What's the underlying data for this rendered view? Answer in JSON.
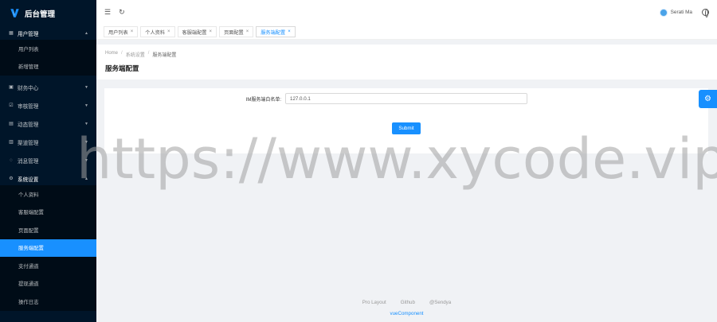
{
  "app": {
    "title": "后台管理"
  },
  "sidebar": {
    "groups": [
      {
        "label": "用户管理",
        "icon": "table-icon",
        "open": true,
        "items": [
          "用户列表",
          "新增管理"
        ]
      },
      {
        "label": "财务中心",
        "icon": "finance-icon"
      },
      {
        "label": "审核管理",
        "icon": "audit-icon"
      },
      {
        "label": "动态管理",
        "icon": "activity-icon"
      },
      {
        "label": "渠道管理",
        "icon": "channel-icon"
      },
      {
        "label": "消息管理",
        "icon": "message-icon"
      },
      {
        "label": "系统设置",
        "icon": "gear-icon",
        "open": true,
        "items": [
          "个人资料",
          "客服端配置",
          "页面配置",
          "服务端配置",
          "支付通道",
          "提现通道",
          "操作日志"
        ]
      }
    ]
  },
  "header": {
    "user_name": "Serati Ma"
  },
  "tabs": [
    {
      "label": "用户列表"
    },
    {
      "label": "个人资料"
    },
    {
      "label": "客服端配置"
    },
    {
      "label": "页面配置"
    },
    {
      "label": "服务端配置",
      "active": true
    }
  ],
  "breadcrumb": {
    "home": "Home",
    "parent": "系统设置",
    "current": "服务端配置"
  },
  "page": {
    "title": "服务端配置"
  },
  "form": {
    "label": "IM服务端白名单:",
    "value": "127.0.0.1",
    "submit_label": "Submit"
  },
  "footer": {
    "links": [
      "Pro Layout",
      "Github",
      "@Sendya"
    ],
    "copyright": "vueComponent"
  },
  "watermark": "https://www.xycode.vip",
  "colors": {
    "primary": "#1890ff",
    "sidebar": "#001529",
    "submenu": "#000c17"
  }
}
